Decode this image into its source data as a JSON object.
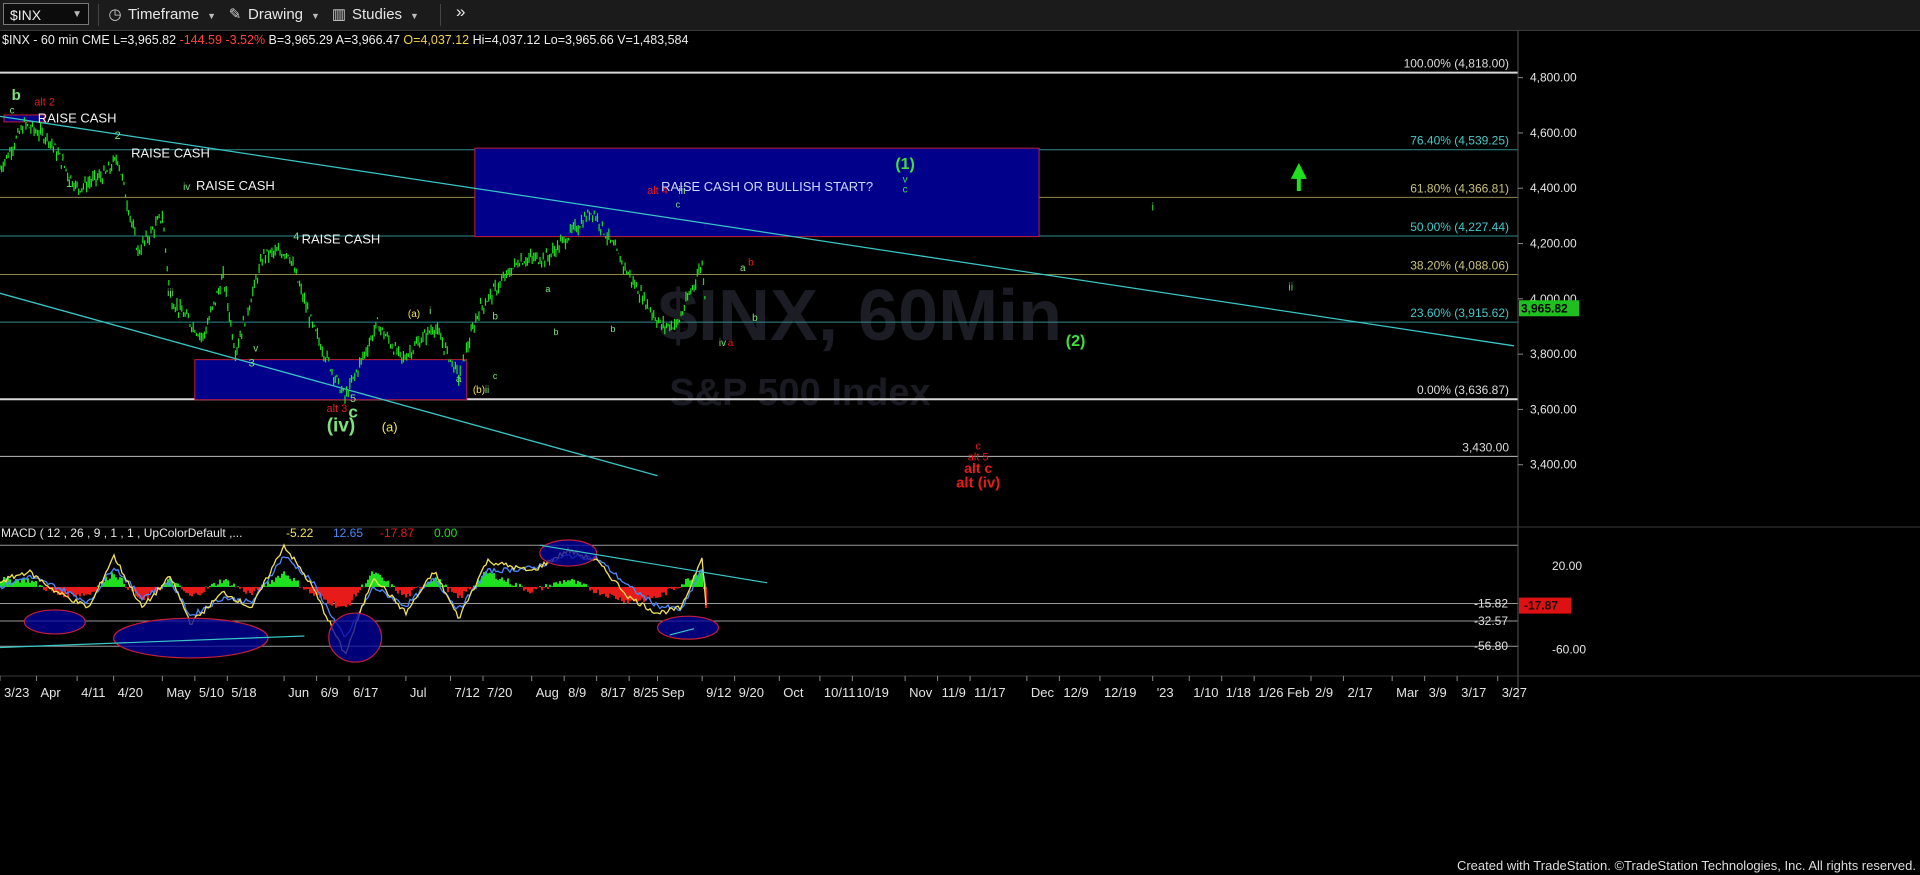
{
  "toolbar": {
    "symbol": "$INX",
    "timeframe": "Timeframe",
    "drawing": "Drawing",
    "studies": "Studies",
    "more": "»"
  },
  "quote": {
    "name": "$INX - 60 min  CME",
    "L": "L=3,965.82",
    "chg": "-144.59",
    "pct": "-3.52%",
    "B": "B=3,965.29",
    "A": "A=3,966.47",
    "O": "O=4,037.12",
    "Hi": "Hi=4,037.12",
    "Lo": "Lo=3,965.66",
    "V": "V=1,483,584"
  },
  "watermark": {
    "title": "$INX, 60Min",
    "subtitle": "S&P 500 Index"
  },
  "colors": {
    "up": "#1fe01f",
    "down": "#e81b1b",
    "fib": "#3ac6c6",
    "box": "#00008b",
    "alt": "#e81b1b",
    "wave": "#7ce37c",
    "macdline": "#4d88ff",
    "signal": "#f2e25a"
  },
  "chart_data": [
    {
      "type": "line",
      "title": "$INX - 60 min",
      "ylim": [
        3200,
        4900
      ],
      "xlim": [
        "2022-03-23",
        "2023-04-01"
      ],
      "y_ticks": [
        3400,
        3600,
        3800,
        4000,
        4200,
        4400,
        4600,
        4800
      ],
      "y_tick_labels": [
        "3,400.00",
        "3,600.00",
        "3,800.00",
        "4,000.00",
        "4,200.00",
        "4,400.00",
        "4,600.00",
        "4,800.00"
      ],
      "last_price": {
        "value": 3965.82,
        "label": "3,965.82"
      },
      "series": [
        {
          "x": [
            "2022-03-23",
            "2022-03-29",
            "2022-04-04",
            "2022-04-11",
            "2022-04-18",
            "2022-04-21",
            "2022-04-26",
            "2022-05-02",
            "2022-05-04",
            "2022-05-12",
            "2022-05-17",
            "2022-05-20",
            "2022-05-27",
            "2022-06-02",
            "2022-06-08",
            "2022-06-16",
            "2022-06-24",
            "2022-06-30",
            "2022-07-08",
            "2022-07-14",
            "2022-07-19",
            "2022-07-29",
            "2022-08-05",
            "2022-08-16",
            "2022-08-26",
            "2022-09-02",
            "2022-09-06",
            "2022-09-12",
            "2022-09-13"
          ],
          "y": [
            4470,
            4630,
            4580,
            4400,
            4450,
            4510,
            4170,
            4300,
            4000,
            3860,
            4080,
            3810,
            4160,
            4170,
            3900,
            3640,
            3910,
            3780,
            3900,
            3720,
            3960,
            4140,
            4150,
            4320,
            4060,
            3900,
            3910,
            4130,
            3965
          ]
        }
      ],
      "fib_levels": [
        {
          "label": "100.00% (4,818.00)",
          "value": 4818
        },
        {
          "label": "76.40% (4,539.25)",
          "value": 4539.25
        },
        {
          "label": "61.80% (4,366.81)",
          "value": 4366.81
        },
        {
          "label": "50.00% (4,227.44)",
          "value": 4227.44
        },
        {
          "label": "38.20% (4,088.06)",
          "value": 4088.06
        },
        {
          "label": "23.60% (3,915.62)",
          "value": 3915.62
        },
        {
          "label": "0.00% (3,636.87)",
          "value": 3636.87
        },
        {
          "label": "3,430.00",
          "value": 3430
        }
      ],
      "boxes": [
        {
          "x": [
            "2022-03-24",
            "2022-04-03"
          ],
          "y": [
            4640,
            4665
          ]
        },
        {
          "x": [
            "2022-05-10",
            "2022-07-16"
          ],
          "y": [
            3635,
            3780
          ]
        },
        {
          "x": [
            "2022-07-18",
            "2022-12-04"
          ],
          "y": [
            4225,
            4545
          ]
        }
      ],
      "trendlines": [
        {
          "x": [
            "2022-03-23",
            "2023-03-31"
          ],
          "y": [
            4660,
            3830
          ]
        },
        {
          "x": [
            "2022-03-23",
            "2022-09-01"
          ],
          "y": [
            4020,
            3360
          ]
        }
      ],
      "annotations": [
        {
          "x": "2022-03-27",
          "y": 4720,
          "text": "b",
          "color": "#7ce37c",
          "size": 15,
          "bold": true
        },
        {
          "x": "2022-04-03",
          "y": 4700,
          "text": "alt 2",
          "color": "#e81b1b",
          "size": 11
        },
        {
          "x": "2022-03-26",
          "y": 4670,
          "text": "c",
          "color": "#7ce37c",
          "size": 10
        },
        {
          "x": "2022-04-11",
          "y": 4638,
          "text": "RAISE CASH",
          "color": "#f0f0f0",
          "size": 13
        },
        {
          "x": "2022-04-21",
          "y": 4578,
          "text": "2",
          "color": "#7ce37c",
          "size": 11
        },
        {
          "x": "2022-05-04",
          "y": 4512,
          "text": "RAISE CASH",
          "color": "#f0f0f0",
          "size": 13
        },
        {
          "x": "2022-04-09",
          "y": 4405,
          "text": "1",
          "color": "#7ce37c",
          "size": 11
        },
        {
          "x": "2022-05-08",
          "y": 4393,
          "text": "iv",
          "color": "#7ce37c",
          "size": 10
        },
        {
          "x": "2022-05-20",
          "y": 4393,
          "text": "RAISE CASH",
          "color": "#f0f0f0",
          "size": 13
        },
        {
          "x": "2022-05-04",
          "y": 4010,
          "text": "iii",
          "color": "#7ce37c",
          "size": 10
        },
        {
          "x": "2022-06-04",
          "y": 4212,
          "text": "4",
          "color": "#7ce37c",
          "size": 11
        },
        {
          "x": "2022-06-15",
          "y": 4200,
          "text": "RAISE CASH",
          "color": "#f0f0f0",
          "size": 13
        },
        {
          "x": "2022-05-25",
          "y": 3810,
          "text": "v",
          "color": "#7ce37c",
          "size": 10
        },
        {
          "x": "2022-05-24",
          "y": 3755,
          "text": "3",
          "color": "#7ce37c",
          "size": 11
        },
        {
          "x": "2022-06-18",
          "y": 3627,
          "text": "5",
          "color": "#7ce37c",
          "size": 11
        },
        {
          "x": "2022-06-14",
          "y": 3590,
          "text": "alt 3",
          "color": "#e81b1b",
          "size": 11
        },
        {
          "x": "2022-06-18",
          "y": 3570,
          "text": "c",
          "color": "#7ce37c",
          "size": 17,
          "bold": true
        },
        {
          "x": "2022-06-15",
          "y": 3520,
          "text": "(iv)",
          "color": "#7ce37c",
          "size": 19,
          "bold": true
        },
        {
          "x": "2022-06-27",
          "y": 3520,
          "text": "(a)",
          "color": "#f2e25a",
          "size": 13
        },
        {
          "x": "2022-07-03",
          "y": 3935,
          "text": "(a)",
          "color": "#f2e25a",
          "size": 10
        },
        {
          "x": "2022-07-07",
          "y": 3945,
          "text": "i",
          "color": "#7ce37c",
          "size": 10
        },
        {
          "x": "2022-07-14",
          "y": 3700,
          "text": "a",
          "color": "#7ce37c",
          "size": 10
        },
        {
          "x": "2022-07-23",
          "y": 3925,
          "text": "b",
          "color": "#7ce37c",
          "size": 10
        },
        {
          "x": "2022-07-19",
          "y": 3660,
          "text": "(b)",
          "color": "#f2e25a",
          "size": 10
        },
        {
          "x": "2022-07-21",
          "y": 3660,
          "text": "ii",
          "color": "#7ce37c",
          "size": 10
        },
        {
          "x": "2022-07-23",
          "y": 3710,
          "text": "c",
          "color": "#7ce37c",
          "size": 9
        },
        {
          "x": "2022-08-05",
          "y": 4025,
          "text": "a",
          "color": "#7ce37c",
          "size": 9
        },
        {
          "x": "2022-08-07",
          "y": 3870,
          "text": "b",
          "color": "#7ce37c",
          "size": 9
        },
        {
          "x": "2022-08-21",
          "y": 3880,
          "text": "b",
          "color": "#7ce37c",
          "size": 9
        },
        {
          "x": "2022-09-01",
          "y": 4380,
          "text": "alt 4",
          "color": "#e81b1b",
          "size": 11
        },
        {
          "x": "2022-09-07",
          "y": 4380,
          "text": "iii",
          "color": "#7ce37c",
          "size": 11
        },
        {
          "x": "2022-09-06",
          "y": 4330,
          "text": "c",
          "color": "#7ce37c",
          "size": 9
        },
        {
          "x": "2022-09-22",
          "y": 4100,
          "text": "a",
          "color": "#7ce37c",
          "size": 10
        },
        {
          "x": "2022-09-24",
          "y": 4120,
          "text": "b",
          "color": "#e81b1b",
          "size": 10
        },
        {
          "x": "2022-09-25",
          "y": 3920,
          "text": "b",
          "color": "#7ce37c",
          "size": 10
        },
        {
          "x": "2022-09-17",
          "y": 3830,
          "text": "iv",
          "color": "#7ce37c",
          "size": 10
        },
        {
          "x": "2022-09-19",
          "y": 3830,
          "text": "a",
          "color": "#e81b1b",
          "size": 10
        },
        {
          "x": "2022-09-28",
          "y": 4390,
          "text": "RAISE CASH OR BULLISH START?",
          "color": "#cfd6ff",
          "size": 13
        },
        {
          "x": "2022-11-01",
          "y": 4470,
          "text": "(1)",
          "color": "#3ee03e",
          "size": 16,
          "bold": true
        },
        {
          "x": "2022-11-01",
          "y": 4420,
          "text": "v",
          "color": "#3ee03e",
          "size": 10
        },
        {
          "x": "2022-11-01",
          "y": 4385,
          "text": "c",
          "color": "#3ee03e",
          "size": 10
        },
        {
          "x": "2022-12-13",
          "y": 3830,
          "text": "(2)",
          "color": "#3ee03e",
          "size": 16,
          "bold": true
        },
        {
          "x": "2023-01-01",
          "y": 4320,
          "text": "i",
          "color": "#3ee03e",
          "size": 11
        },
        {
          "x": "2023-02-04",
          "y": 4030,
          "text": "ii",
          "color": "#3ee03e",
          "size": 11
        },
        {
          "x": "2022-11-19",
          "y": 3455,
          "text": "c",
          "color": "#e81b1b",
          "size": 11
        },
        {
          "x": "2022-11-19",
          "y": 3415,
          "text": "alt 5",
          "color": "#e81b1b",
          "size": 11
        },
        {
          "x": "2022-11-19",
          "y": 3370,
          "text": "alt c",
          "color": "#e81b1b",
          "size": 14,
          "bold": true
        },
        {
          "x": "2022-11-19",
          "y": 3318,
          "text": "alt (iv)",
          "color": "#e81b1b",
          "size": 15,
          "bold": true
        }
      ],
      "arrow": {
        "x": "2023-02-06",
        "y_from": 4390,
        "y_to": 4470
      }
    },
    {
      "type": "line",
      "title": "MACD ( 12 , 26 , 9 , 1 , 1 , UpColorDefault ,...",
      "values": [
        {
          "text": "-5.22",
          "color": "#f2e25a"
        },
        {
          "text": "12.65",
          "color": "#4d88ff"
        },
        {
          "text": "-17.87",
          "color": "#e81b1b"
        },
        {
          "text": "0.00",
          "color": "#1fe01f"
        }
      ],
      "ylim": [
        -70,
        45
      ],
      "y_ticks": [
        20,
        -60
      ],
      "y_tick_labels": [
        "20.00",
        "-60.00"
      ],
      "levels": [
        {
          "value": 40,
          "label": ""
        },
        {
          "value": -15.82,
          "label": "-15.82"
        },
        {
          "value": -32.57,
          "label": "-32.57"
        },
        {
          "value": -56.8,
          "label": "-56.80"
        }
      ],
      "last_value": {
        "value": -17.87,
        "label": "-17.87"
      },
      "series": [
        {
          "name": "MACD",
          "x": [
            "2022-03-23",
            "2022-03-30",
            "2022-04-06",
            "2022-04-14",
            "2022-04-20",
            "2022-04-27",
            "2022-05-04",
            "2022-05-09",
            "2022-05-17",
            "2022-05-24",
            "2022-06-01",
            "2022-06-08",
            "2022-06-16",
            "2022-06-23",
            "2022-07-01",
            "2022-07-08",
            "2022-07-14",
            "2022-07-21",
            "2022-08-01",
            "2022-08-10",
            "2022-08-17",
            "2022-08-25",
            "2022-09-01",
            "2022-09-07",
            "2022-09-12",
            "2022-09-13"
          ],
          "y": [
            5,
            15,
            -5,
            -20,
            30,
            -20,
            10,
            -35,
            -5,
            -20,
            40,
            0,
            -65,
            10,
            -25,
            15,
            -30,
            25,
            15,
            35,
            25,
            -10,
            -25,
            -20,
            30,
            -20
          ]
        },
        {
          "name": "Signal",
          "x": [
            "2022-03-23",
            "2022-03-30",
            "2022-04-06",
            "2022-04-14",
            "2022-04-20",
            "2022-04-27",
            "2022-05-04",
            "2022-05-09",
            "2022-05-17",
            "2022-05-24",
            "2022-06-01",
            "2022-06-08",
            "2022-06-16",
            "2022-06-23",
            "2022-07-01",
            "2022-07-08",
            "2022-07-14",
            "2022-07-21",
            "2022-08-01",
            "2022-08-10",
            "2022-08-17",
            "2022-08-25",
            "2022-09-01",
            "2022-09-07",
            "2022-09-12",
            "2022-09-13"
          ],
          "y": [
            0,
            10,
            0,
            -15,
            20,
            -10,
            5,
            -28,
            -10,
            -15,
            30,
            5,
            -50,
            0,
            -18,
            8,
            -22,
            15,
            18,
            30,
            28,
            0,
            -18,
            -22,
            18,
            -5
          ]
        }
      ],
      "ellipses": [
        {
          "x": [
            "2022-03-29",
            "2022-04-13"
          ],
          "y": [
            -45,
            -22
          ]
        },
        {
          "x": [
            "2022-04-20",
            "2022-05-28"
          ],
          "y": [
            -68,
            -30
          ]
        },
        {
          "x": [
            "2022-06-12",
            "2022-06-25"
          ],
          "y": [
            -72,
            -25
          ]
        },
        {
          "x": [
            "2022-08-03",
            "2022-08-17"
          ],
          "y": [
            20,
            45
          ]
        },
        {
          "x": [
            "2022-09-01",
            "2022-09-16"
          ],
          "y": [
            -50,
            -28
          ]
        }
      ],
      "trendlines": [
        {
          "x": [
            "2022-03-23",
            "2022-06-06"
          ],
          "y": [
            -58,
            -47
          ]
        },
        {
          "x": [
            "2022-08-03",
            "2022-09-28"
          ],
          "y": [
            40,
            4
          ]
        },
        {
          "x": [
            "2022-09-04",
            "2022-09-10"
          ],
          "y": [
            -46,
            -40
          ]
        }
      ]
    }
  ],
  "x_axis": {
    "labels": [
      {
        "x": "2022-03-23",
        "text": "3/23"
      },
      {
        "x": "2022-04-01",
        "text": "Apr"
      },
      {
        "x": "2022-04-11",
        "text": "4/11"
      },
      {
        "x": "2022-04-20",
        "text": "4/20"
      },
      {
        "x": "2022-05-02",
        "text": "May"
      },
      {
        "x": "2022-05-10",
        "text": "5/10"
      },
      {
        "x": "2022-05-18",
        "text": "5/18"
      },
      {
        "x": "2022-06-01",
        "text": "Jun"
      },
      {
        "x": "2022-06-09",
        "text": "6/9"
      },
      {
        "x": "2022-06-17",
        "text": "6/17"
      },
      {
        "x": "2022-07-01",
        "text": "Jul"
      },
      {
        "x": "2022-07-12",
        "text": "7/12"
      },
      {
        "x": "2022-07-20",
        "text": "7/20"
      },
      {
        "x": "2022-08-01",
        "text": "Aug"
      },
      {
        "x": "2022-08-09",
        "text": "8/9"
      },
      {
        "x": "2022-08-17",
        "text": "8/17"
      },
      {
        "x": "2022-08-25",
        "text": "8/25"
      },
      {
        "x": "2022-09-01",
        "text": "Sep"
      },
      {
        "x": "2022-09-12",
        "text": "9/12"
      },
      {
        "x": "2022-09-20",
        "text": "9/20"
      },
      {
        "x": "2022-10-01",
        "text": "Oct"
      },
      {
        "x": "2022-10-11",
        "text": "10/11"
      },
      {
        "x": "2022-10-19",
        "text": "10/19"
      },
      {
        "x": "2022-11-01",
        "text": "Nov"
      },
      {
        "x": "2022-11-09",
        "text": "11/9"
      },
      {
        "x": "2022-11-17",
        "text": "11/17"
      },
      {
        "x": "2022-12-01",
        "text": "Dec"
      },
      {
        "x": "2022-12-09",
        "text": "12/9"
      },
      {
        "x": "2022-12-19",
        "text": "12/19"
      },
      {
        "x": "2023-01-01",
        "text": "'23"
      },
      {
        "x": "2023-01-10",
        "text": "1/10"
      },
      {
        "x": "2023-01-18",
        "text": "1/18"
      },
      {
        "x": "2023-01-26",
        "text": "1/26 Feb"
      },
      {
        "x": "2023-02-09",
        "text": "2/9"
      },
      {
        "x": "2023-02-17",
        "text": "2/17"
      },
      {
        "x": "2023-03-01",
        "text": "Mar"
      },
      {
        "x": "2023-03-09",
        "text": "3/9"
      },
      {
        "x": "2023-03-17",
        "text": "3/17"
      },
      {
        "x": "2023-03-27",
        "text": "3/27"
      }
    ]
  },
  "footer": "Created with TradeStation. ©TradeStation Technologies, Inc. All rights reserved."
}
